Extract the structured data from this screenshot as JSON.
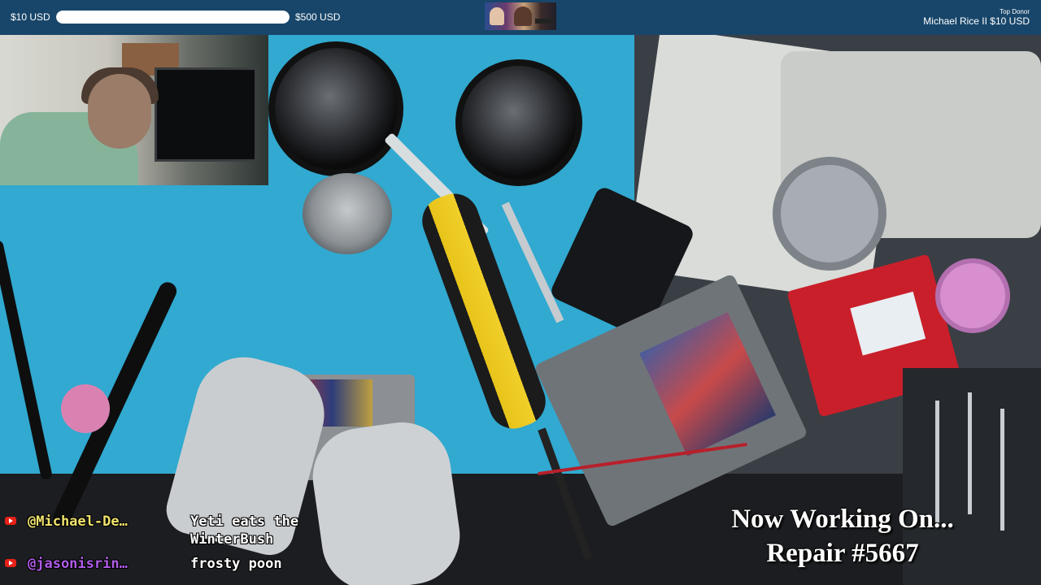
{
  "goal": {
    "start_label": "$10 USD",
    "end_label": "$500 USD",
    "progress_fraction": 1.0
  },
  "top_donor": {
    "label": "Top Donor",
    "name_amount": "Michael Rice II $10 USD"
  },
  "chat": [
    {
      "user": "@Michael-De…",
      "message_line1": "Yeti eats the",
      "message_line2": "WinterBush",
      "user_color": "#efe26b"
    },
    {
      "user": "@jasonisrin…",
      "message_line1": "frosty poon",
      "message_line2": "",
      "user_color": "#b05ce8"
    }
  ],
  "caption": {
    "line1": "Now Working On...",
    "line2": "Repair #5667"
  },
  "colors": {
    "topbar": "#18466a",
    "bench": "#31a9d0",
    "caption_text": "#ffffff"
  },
  "icons": {
    "chat_platform": "youtube-icon"
  }
}
